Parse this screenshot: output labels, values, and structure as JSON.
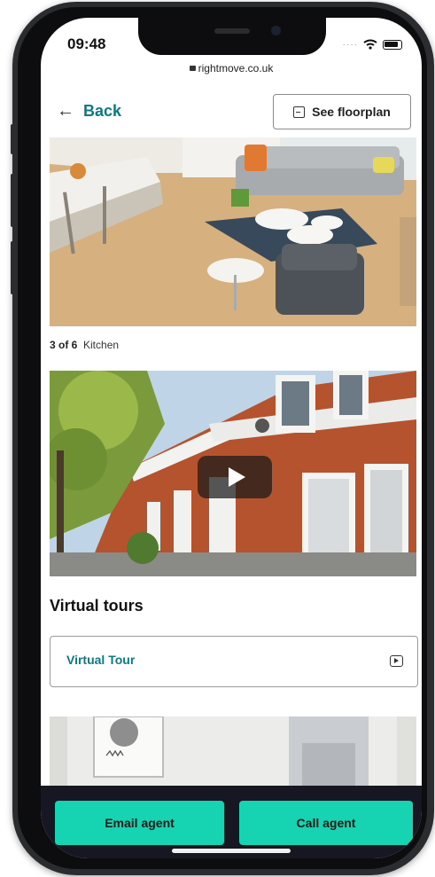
{
  "status_bar": {
    "time": "09:48"
  },
  "browser": {
    "url": "rightmove.co.uk"
  },
  "header": {
    "back_label": "Back",
    "floorplan_label": "See floorplan"
  },
  "gallery": {
    "position": "3 of 6",
    "room": "Kitchen"
  },
  "virtual_tours": {
    "heading": "Virtual tours",
    "items": [
      {
        "label": "Virtual Tour"
      }
    ]
  },
  "actions": {
    "email_label": "Email agent",
    "call_label": "Call agent"
  },
  "colors": {
    "accent": "#0b7a83",
    "cta": "#16d3b2",
    "bottom_bar": "#161722"
  }
}
